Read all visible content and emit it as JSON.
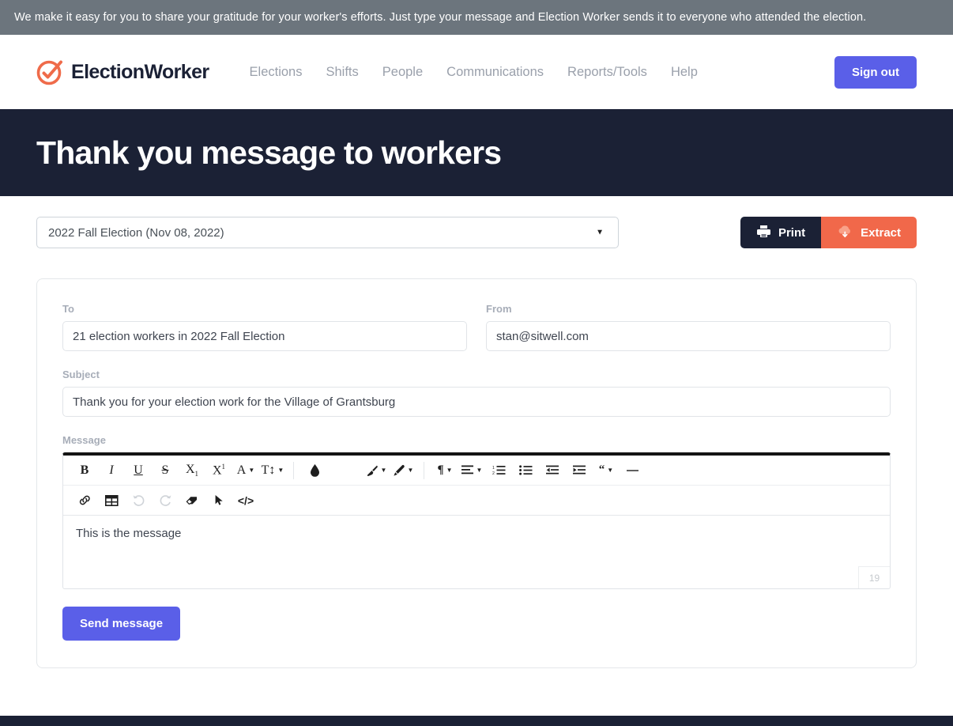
{
  "banner": {
    "text": "We make it easy for you to share your gratitude for your worker's efforts. Just type your message and Election Worker sends it to everyone who attended the election."
  },
  "nav": {
    "brand": "ElectionWorker",
    "brand_icon": "check-circle-icon",
    "links": [
      {
        "label": "Elections"
      },
      {
        "label": "Shifts"
      },
      {
        "label": "People"
      },
      {
        "label": "Communications"
      },
      {
        "label": "Reports/Tools"
      },
      {
        "label": "Help"
      }
    ],
    "signout_label": "Sign out"
  },
  "page": {
    "title": "Thank you message to workers"
  },
  "toolbar": {
    "election_select_value": "2022 Fall Election (Nov 08, 2022)",
    "print_label": "Print",
    "print_icon": "printer-icon",
    "extract_label": "Extract",
    "extract_icon": "cloud-download-icon"
  },
  "form": {
    "to_label": "To",
    "to_value": "21 election workers in 2022 Fall Election",
    "from_label": "From",
    "from_value": "stan@sitwell.com",
    "subject_label": "Subject",
    "subject_value": "Thank you for your election work for the Village of Grantsburg",
    "message_label": "Message",
    "message_value": "This is the message",
    "char_count": "19",
    "send_label": "Send message"
  },
  "editor_toolbar": {
    "row1": [
      {
        "name": "bold-icon",
        "glyph": "B",
        "caret": false,
        "sep_after": false
      },
      {
        "name": "italic-icon",
        "glyph": "I",
        "caret": false,
        "sep_after": false
      },
      {
        "name": "underline-icon",
        "glyph": "U",
        "caret": false,
        "sep_after": false
      },
      {
        "name": "strikethrough-icon",
        "glyph": "S",
        "caret": false,
        "sep_after": false
      },
      {
        "name": "subscript-icon",
        "glyph": "X",
        "caret": false,
        "sep_after": false
      },
      {
        "name": "superscript-icon",
        "glyph": "X",
        "caret": false,
        "sep_after": false
      },
      {
        "name": "font-color-icon",
        "glyph": "A",
        "caret": true,
        "sep_after": false
      },
      {
        "name": "font-size-icon",
        "glyph": "T",
        "caret": true,
        "sep_after": true
      },
      {
        "name": "background-color-icon",
        "glyph": "",
        "caret": false,
        "sep_after": false
      }
    ],
    "row1b": [
      {
        "name": "highlight-brush-icon",
        "caret": true,
        "sep_after": false
      },
      {
        "name": "text-marker-icon",
        "caret": true,
        "sep_after": true
      },
      {
        "name": "paragraph-format-icon",
        "caret": true,
        "sep_after": false
      },
      {
        "name": "align-icon",
        "caret": true,
        "sep_after": false
      },
      {
        "name": "ordered-list-icon",
        "caret": false,
        "sep_after": false
      },
      {
        "name": "unordered-list-icon",
        "caret": false,
        "sep_after": false
      },
      {
        "name": "outdent-icon",
        "caret": false,
        "sep_after": false
      },
      {
        "name": "indent-icon",
        "caret": false,
        "sep_after": false
      },
      {
        "name": "blockquote-icon",
        "caret": true,
        "sep_after": false
      },
      {
        "name": "horizontal-rule-icon",
        "caret": false,
        "sep_after": false
      }
    ],
    "row2": [
      {
        "name": "link-icon",
        "dim": false
      },
      {
        "name": "table-icon",
        "dim": false
      },
      {
        "name": "undo-icon",
        "dim": true
      },
      {
        "name": "redo-icon",
        "dim": true
      },
      {
        "name": "clear-format-icon",
        "dim": false
      },
      {
        "name": "select-all-icon",
        "dim": false
      },
      {
        "name": "code-view-icon",
        "dim": false
      }
    ]
  },
  "colors": {
    "banner_bg": "#6c757d",
    "dark_navy": "#1b2135",
    "accent_blue": "#5a5fe8",
    "accent_orange": "#f1684a",
    "muted_text": "#9aa0ab"
  }
}
